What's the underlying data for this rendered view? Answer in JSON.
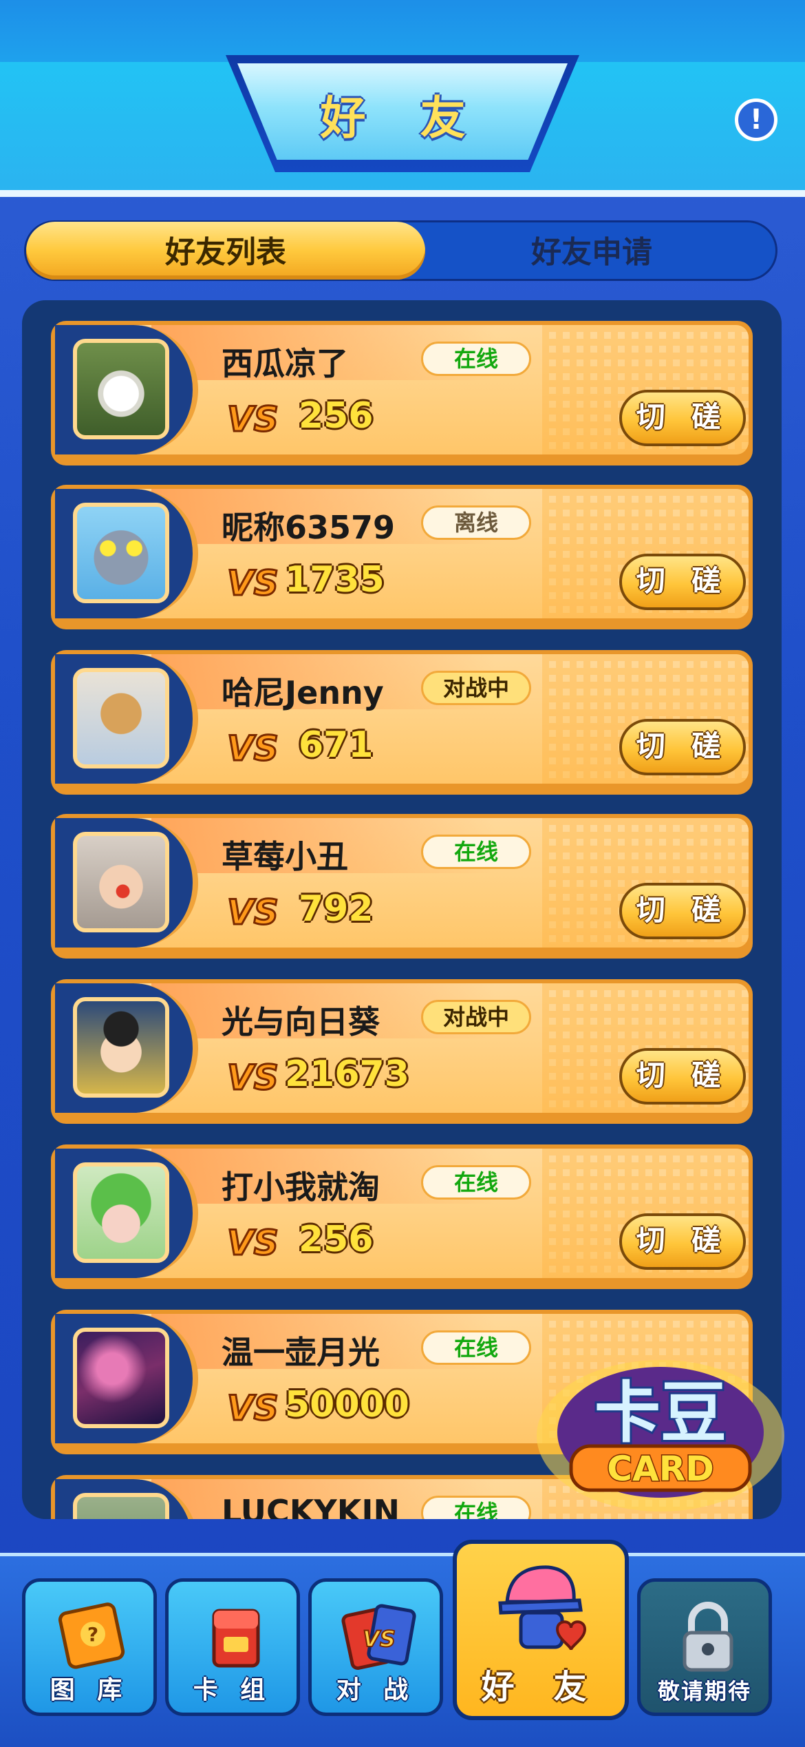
{
  "header": {
    "title": "好 友",
    "help_icon": "exclamation-icon",
    "help_glyph": "!"
  },
  "tabs": [
    {
      "label": "好友列表",
      "active": true
    },
    {
      "label": "好友申请",
      "active": false
    }
  ],
  "friends": [
    {
      "nickname": "西瓜凉了",
      "status": "在线",
      "status_kind": "online",
      "score": "256",
      "action": "切 磋",
      "avatar": "goose-avatar"
    },
    {
      "nickname": "昵称63579",
      "status": "离线",
      "status_kind": "offline",
      "score": "1735",
      "action": "切 磋",
      "avatar": "cat-sunglasses-avatar"
    },
    {
      "nickname": "哈尼Jenny",
      "status": "对战中",
      "status_kind": "battle",
      "score": "671",
      "action": "切 磋",
      "avatar": "shiba-avatar"
    },
    {
      "nickname": "草莓小丑",
      "status": "在线",
      "status_kind": "online",
      "score": "792",
      "action": "切 磋",
      "avatar": "child-clown-avatar"
    },
    {
      "nickname": "光与向日葵",
      "status": "对战中",
      "status_kind": "battle",
      "score": "21673",
      "action": "切 磋",
      "avatar": "cartoon-boy-avatar"
    },
    {
      "nickname": "打小我就淘",
      "status": "在线",
      "status_kind": "online",
      "score": "256",
      "action": "切 磋",
      "avatar": "frog-hat-avatar"
    },
    {
      "nickname": "温一壶月光",
      "status": "在线",
      "status_kind": "online",
      "score": "50000",
      "action": "",
      "avatar": "galaxy-avatar"
    },
    {
      "nickname": "LUCKYKIN",
      "status": "在线",
      "status_kind": "online",
      "score": "",
      "action": "",
      "avatar": "partial-avatar"
    }
  ],
  "vs_label": "VS",
  "badge": {
    "top": "卡豆",
    "bottom": "CARD"
  },
  "nav": [
    {
      "label": "图 库",
      "icon": "book-icon"
    },
    {
      "label": "卡 组",
      "icon": "card-box-icon"
    },
    {
      "label": "对 战",
      "icon": "vs-cards-icon"
    },
    {
      "label": "好 友",
      "icon": "friend-cap-icon",
      "active": true
    },
    {
      "label": "敬请期待",
      "icon": "lock-icon",
      "locked": true
    }
  ],
  "colors": {
    "accent": "#ffc93d",
    "online": "#13a80f",
    "panel": "#143874"
  }
}
